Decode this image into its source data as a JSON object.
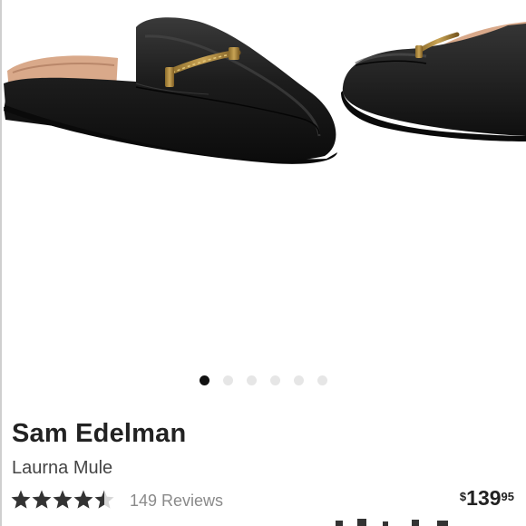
{
  "product": {
    "brand": "Sam Edelman",
    "name": "Laurna Mule",
    "rating": 4.5,
    "rating_max": 5,
    "reviews_label": "149 Reviews",
    "price": {
      "currency": "$",
      "dollars": "139",
      "cents": "95"
    }
  },
  "carousel": {
    "image_description": "black leather mules with gold horsebit hardware",
    "slide_count": 6,
    "active_index": 0
  },
  "colors": {
    "star_filled": "#333333",
    "star_empty": "#d6d6d6",
    "dot_active": "#111111",
    "dot_inactive": "#e6e6e6",
    "leather": "#1c1c1c",
    "lining": "#d9a98a",
    "hardware": "#b08a3e"
  }
}
